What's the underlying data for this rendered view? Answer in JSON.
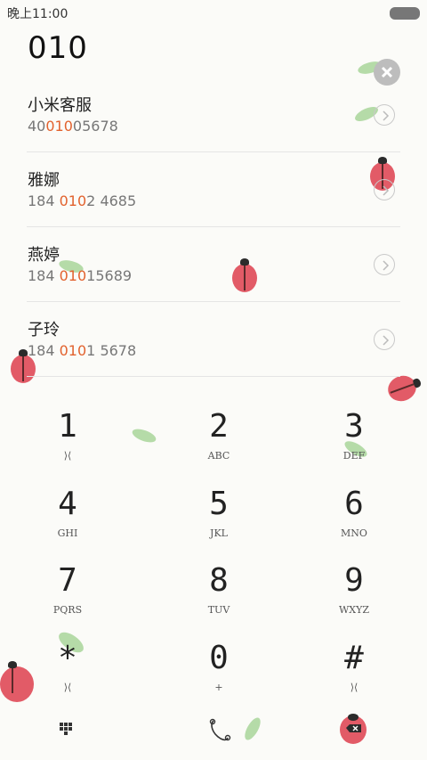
{
  "status": {
    "time": "晚上11:00"
  },
  "dial": {
    "number": "010"
  },
  "contacts": [
    {
      "name": "小米客服",
      "phone_pre": "40",
      "phone_match": "010",
      "phone_post": "05678"
    },
    {
      "name": "雅娜",
      "phone_pre": "184 ",
      "phone_match": "010",
      "phone_post": "2 4685"
    },
    {
      "name": "燕婷",
      "phone_pre": "184 ",
      "phone_match": "010",
      "phone_post": "15689"
    },
    {
      "name": "子玲",
      "phone_pre": "184 ",
      "phone_match": "010",
      "phone_post": "1 5678"
    }
  ],
  "keys": [
    {
      "digit": "1",
      "letters": "⟩⟨"
    },
    {
      "digit": "2",
      "letters": "ABC"
    },
    {
      "digit": "3",
      "letters": "DEF"
    },
    {
      "digit": "4",
      "letters": "GHI"
    },
    {
      "digit": "5",
      "letters": "JKL"
    },
    {
      "digit": "6",
      "letters": "MNO"
    },
    {
      "digit": "7",
      "letters": "PQRS"
    },
    {
      "digit": "8",
      "letters": "TUV"
    },
    {
      "digit": "9",
      "letters": "WXYZ"
    },
    {
      "digit": "*",
      "letters": "⟩⟨"
    },
    {
      "digit": "0",
      "letters": "+"
    },
    {
      "digit": "#",
      "letters": "⟩⟨"
    }
  ],
  "icons": {
    "clear": "clear-icon",
    "arrow": "chevron-right-icon",
    "keypad": "keypad-icon",
    "call": "call-icon",
    "backspace": "backspace-icon"
  },
  "colors": {
    "highlight": "#e2622e",
    "ladybug": "#e25b67",
    "leaf": "#a8d59a"
  }
}
